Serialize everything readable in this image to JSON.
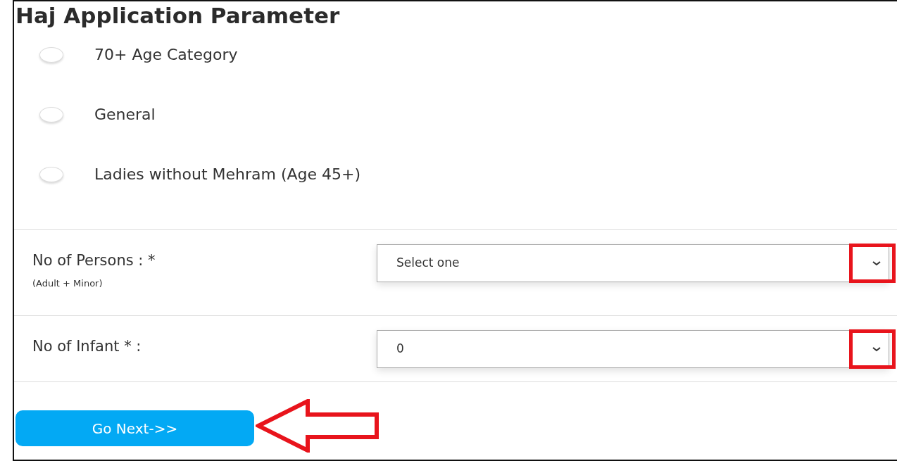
{
  "title": "Haj Application Parameter",
  "categories": [
    {
      "label": "70+ Age Category",
      "selected": false
    },
    {
      "label": "General",
      "selected": false
    },
    {
      "label": "Ladies without Mehram (Age 45+)",
      "selected": false
    }
  ],
  "fields": [
    {
      "label": "No of Persons : *",
      "note": "(Adult + Minor)",
      "value": "Select one",
      "caret_highlighted": true
    },
    {
      "label": "No of Infant * :",
      "value": "0",
      "caret_highlighted": true
    }
  ],
  "button": {
    "label": "Go Next->>",
    "pointed_at": true
  }
}
